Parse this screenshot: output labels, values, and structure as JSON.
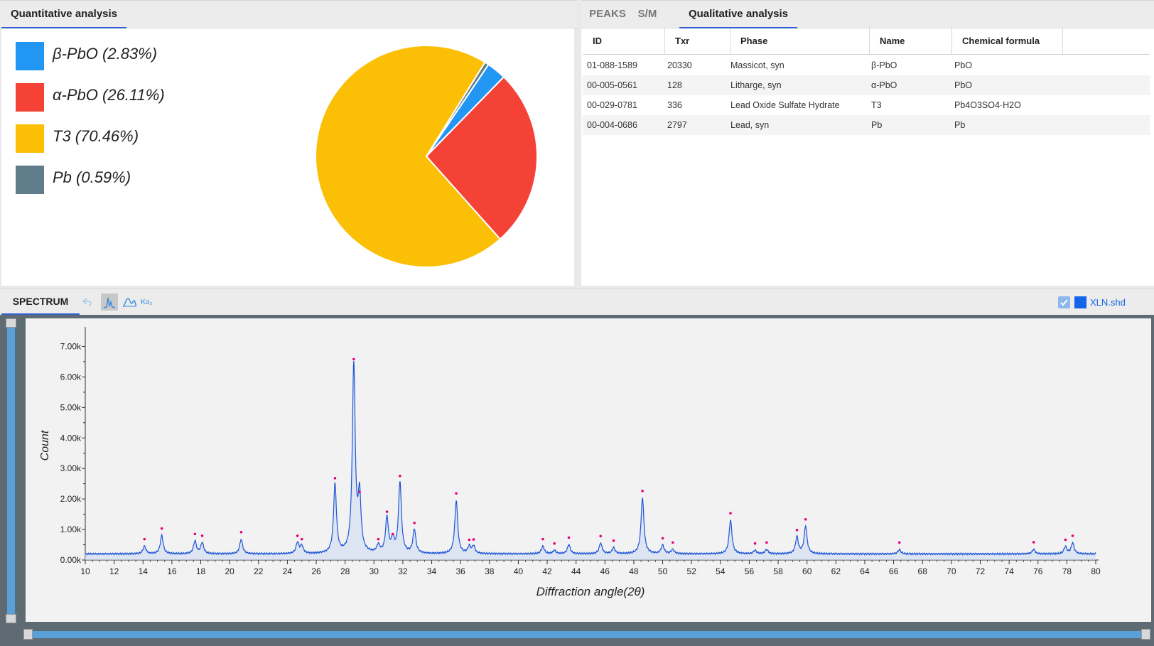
{
  "quantitative": {
    "tab_label": "Quantitative analysis",
    "legend": [
      {
        "label": "β-PbO (2.83%)",
        "color": "#2196f3",
        "percent": 2.83
      },
      {
        "label": "α-PbO (26.11%)",
        "color": "#f44336",
        "percent": 26.11
      },
      {
        "label": "T3 (70.46%)",
        "color": "#fbbf05",
        "percent": 70.46
      },
      {
        "label": "Pb (0.59%)",
        "color": "#607d8b",
        "percent": 0.59
      }
    ]
  },
  "qualitative": {
    "tabs": [
      {
        "label": "PEAKS",
        "active": false
      },
      {
        "label": "S/M",
        "active": false
      },
      {
        "label": "Qualitative analysis",
        "active": true
      }
    ],
    "columns": [
      "ID",
      "Txr",
      "Phase",
      "Name",
      "Chemical formula"
    ],
    "rows": [
      [
        "01-088-1589",
        "20330",
        "Massicot, syn",
        "β-PbO",
        "PbO"
      ],
      [
        "00-005-0561",
        "128",
        "Litharge, syn",
        "α-PbO",
        "PbO"
      ],
      [
        "00-029-0781",
        "336",
        "Lead Oxide Sulfate Hydrate",
        "T3",
        "Pb4O3SO4·H2O"
      ],
      [
        "00-004-0686",
        "2797",
        "Lead, syn",
        "Pb",
        "Pb"
      ]
    ]
  },
  "spectrum": {
    "tab_label": "SPECTRUM",
    "toolbar": {
      "undo_icon": "undo-icon",
      "peak_icon": "peak-icon",
      "smooth_icon": "smooth-icon",
      "kalpha_label": "Kα₂"
    },
    "file": {
      "label": "XLN.shd",
      "checked": true,
      "color": "#1565e8"
    }
  },
  "chart_data": {
    "type": "line",
    "xlabel": "Diffraction angle(2θ)",
    "ylabel": "Count",
    "xlim": [
      10,
      80
    ],
    "ylim": [
      0,
      7500
    ],
    "x_ticks": [
      10,
      12,
      14,
      16,
      18,
      20,
      22,
      24,
      26,
      28,
      30,
      32,
      34,
      36,
      38,
      40,
      42,
      44,
      46,
      48,
      50,
      52,
      54,
      56,
      58,
      60,
      62,
      64,
      66,
      68,
      70,
      72,
      74,
      76,
      78,
      80
    ],
    "y_ticks": [
      0,
      1000,
      2000,
      3000,
      4000,
      5000,
      6000,
      7000
    ],
    "y_tick_labels": [
      "0.00k",
      "1.00k",
      "2.00k",
      "3.00k",
      "4.00k",
      "5.00k",
      "6.00k",
      "7.00k"
    ],
    "baseline": 200,
    "series_color": "#1f56d6",
    "marker_color": "#e8007a",
    "peaks": [
      {
        "x": 14.1,
        "y": 450
      },
      {
        "x": 15.3,
        "y": 800
      },
      {
        "x": 17.6,
        "y": 620
      },
      {
        "x": 18.1,
        "y": 560
      },
      {
        "x": 20.8,
        "y": 680
      },
      {
        "x": 24.7,
        "y": 560
      },
      {
        "x": 25.0,
        "y": 450
      },
      {
        "x": 27.3,
        "y": 2450
      },
      {
        "x": 28.6,
        "y": 6350
      },
      {
        "x": 29.0,
        "y": 2000
      },
      {
        "x": 30.3,
        "y": 450
      },
      {
        "x": 30.9,
        "y": 1350
      },
      {
        "x": 31.3,
        "y": 620
      },
      {
        "x": 31.8,
        "y": 2520
      },
      {
        "x": 32.8,
        "y": 980
      },
      {
        "x": 35.7,
        "y": 1950
      },
      {
        "x": 36.6,
        "y": 430
      },
      {
        "x": 36.9,
        "y": 440
      },
      {
        "x": 41.7,
        "y": 450
      },
      {
        "x": 42.5,
        "y": 310
      },
      {
        "x": 43.5,
        "y": 500
      },
      {
        "x": 45.7,
        "y": 550
      },
      {
        "x": 46.6,
        "y": 400
      },
      {
        "x": 48.6,
        "y": 2030
      },
      {
        "x": 50.0,
        "y": 480
      },
      {
        "x": 50.7,
        "y": 340
      },
      {
        "x": 54.7,
        "y": 1300
      },
      {
        "x": 56.4,
        "y": 310
      },
      {
        "x": 57.2,
        "y": 340
      },
      {
        "x": 59.3,
        "y": 750
      },
      {
        "x": 59.9,
        "y": 1100
      },
      {
        "x": 66.4,
        "y": 340
      },
      {
        "x": 75.7,
        "y": 350
      },
      {
        "x": 77.9,
        "y": 430
      },
      {
        "x": 78.4,
        "y": 560
      }
    ]
  }
}
